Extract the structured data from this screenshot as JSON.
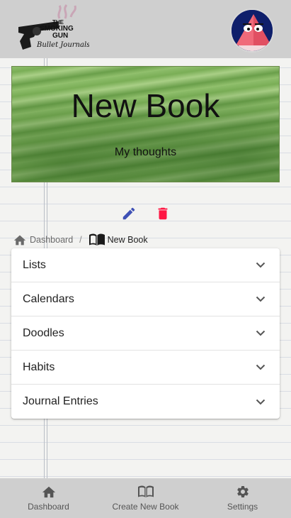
{
  "header": {
    "logo": {
      "text_line1": "THE",
      "text_line2": "SMOKING",
      "text_line3": "GUN",
      "text_line4": "Bullet Journals",
      "icon": "revolver-logo"
    },
    "avatar_icon": "triangle-character-avatar"
  },
  "hero": {
    "title": "New Book",
    "subtitle": "My thoughts"
  },
  "actions": {
    "edit_icon": "pencil-icon",
    "edit_color": "#3f51b5",
    "delete_icon": "trash-icon",
    "delete_color": "#ff1744"
  },
  "breadcrumb": {
    "items": [
      {
        "label": "Dashboard",
        "icon": "home-icon"
      },
      {
        "label": "New Book",
        "icon": "book-icon"
      }
    ],
    "separator": "/"
  },
  "accordion": {
    "items": [
      {
        "label": "Lists"
      },
      {
        "label": "Calendars"
      },
      {
        "label": "Doodles"
      },
      {
        "label": "Habits"
      },
      {
        "label": "Journal Entries"
      }
    ]
  },
  "bottom_nav": {
    "items": [
      {
        "label": "Dashboard",
        "icon": "home-icon"
      },
      {
        "label": "Create New Book",
        "icon": "book-open-icon"
      },
      {
        "label": "Settings",
        "icon": "gear-icon"
      }
    ]
  }
}
